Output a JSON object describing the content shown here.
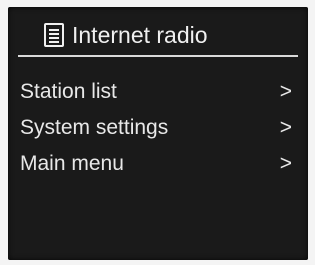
{
  "header": {
    "icon": "list-icon",
    "title": "Internet radio"
  },
  "menu": {
    "items": [
      {
        "label": "Station list",
        "arrow": ">"
      },
      {
        "label": "System settings",
        "arrow": ">"
      },
      {
        "label": "Main menu",
        "arrow": ">"
      }
    ]
  },
  "colors": {
    "screen_background": "#1a1a1a",
    "text": "#e8e8e8",
    "divider": "#d9d9d9"
  }
}
